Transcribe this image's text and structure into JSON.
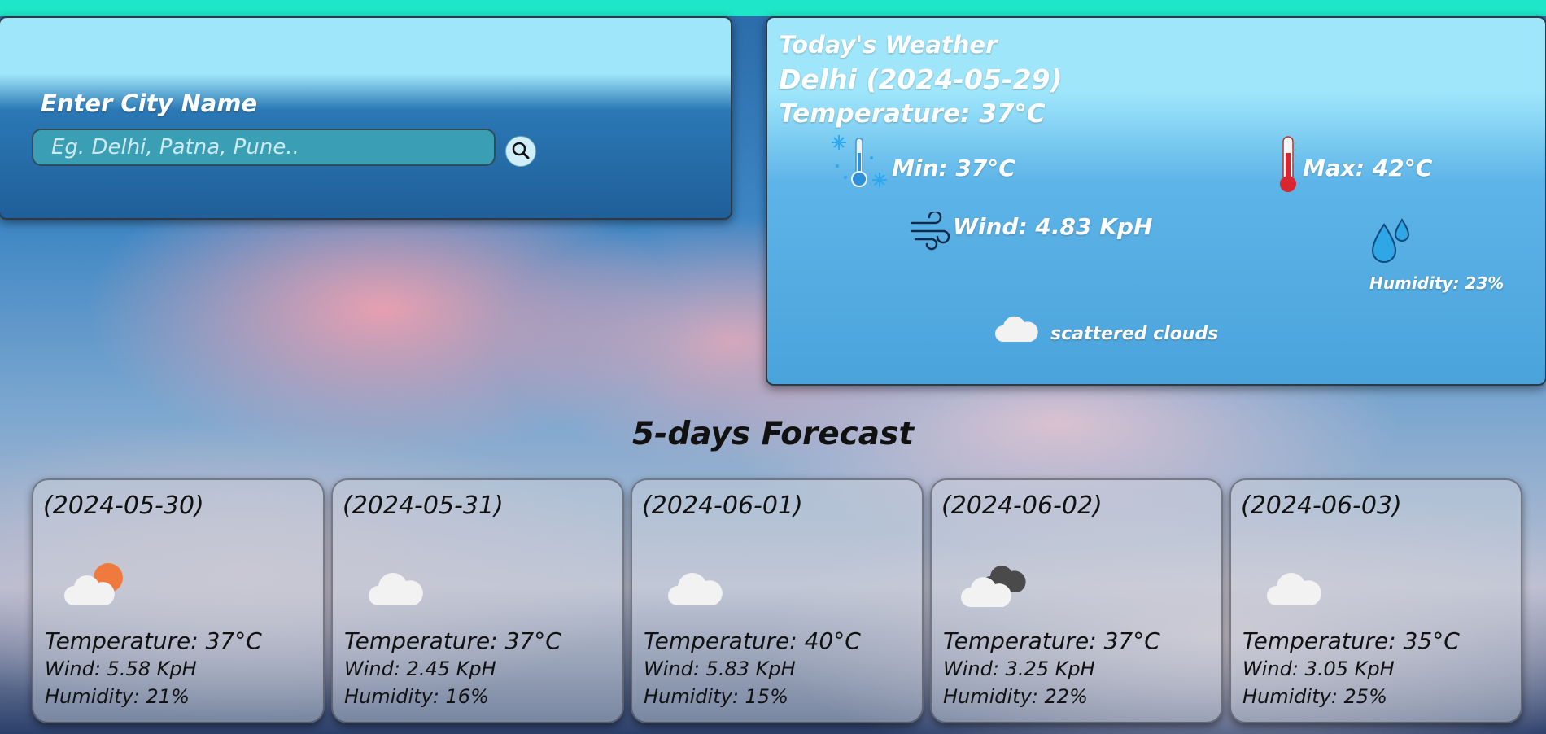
{
  "search": {
    "label": "Enter City Name",
    "placeholder": "Eg. Delhi, Patna, Pune..",
    "value": ""
  },
  "today": {
    "title": "Today's Weather",
    "city_date": "Delhi (2024-05-29)",
    "temperature": "Temperature: 37°C",
    "min": "Min: 37°C",
    "max": "Max: 42°C",
    "wind": "Wind: 4.83 KpH",
    "humidity": "Humidity: 23%",
    "condition": "scattered clouds",
    "icons": {
      "min": "thermometer-cold-icon",
      "max": "thermometer-hot-icon",
      "wind": "wind-icon",
      "humidity": "water-drops-icon",
      "condition": "cloud-icon"
    }
  },
  "forecast": {
    "title": "5-days Forecast",
    "days": [
      {
        "date": "(2024-05-30)",
        "icon": "cloud-sun-icon",
        "temperature": "Temperature: 37°C",
        "wind": "Wind: 5.58 KpH",
        "humidity": "Humidity: 21%"
      },
      {
        "date": "(2024-05-31)",
        "icon": "cloud-icon",
        "temperature": "Temperature: 37°C",
        "wind": "Wind: 2.45 KpH",
        "humidity": "Humidity: 16%"
      },
      {
        "date": "(2024-06-01)",
        "icon": "cloud-icon",
        "temperature": "Temperature: 40°C",
        "wind": "Wind: 5.83 KpH",
        "humidity": "Humidity: 15%"
      },
      {
        "date": "(2024-06-02)",
        "icon": "broken-clouds-icon",
        "temperature": "Temperature: 37°C",
        "wind": "Wind: 3.25 KpH",
        "humidity": "Humidity: 22%"
      },
      {
        "date": "(2024-06-03)",
        "icon": "cloud-icon",
        "temperature": "Temperature: 35°C",
        "wind": "Wind: 3.05 KpH",
        "humidity": "Humidity: 25%"
      }
    ]
  },
  "colors": {
    "top_bar": "#1ee6c8",
    "panel_light": "#9fe6fb",
    "input_bg": "#3a9fb4",
    "text_light": "#ffffff",
    "text_dark": "#111111"
  }
}
